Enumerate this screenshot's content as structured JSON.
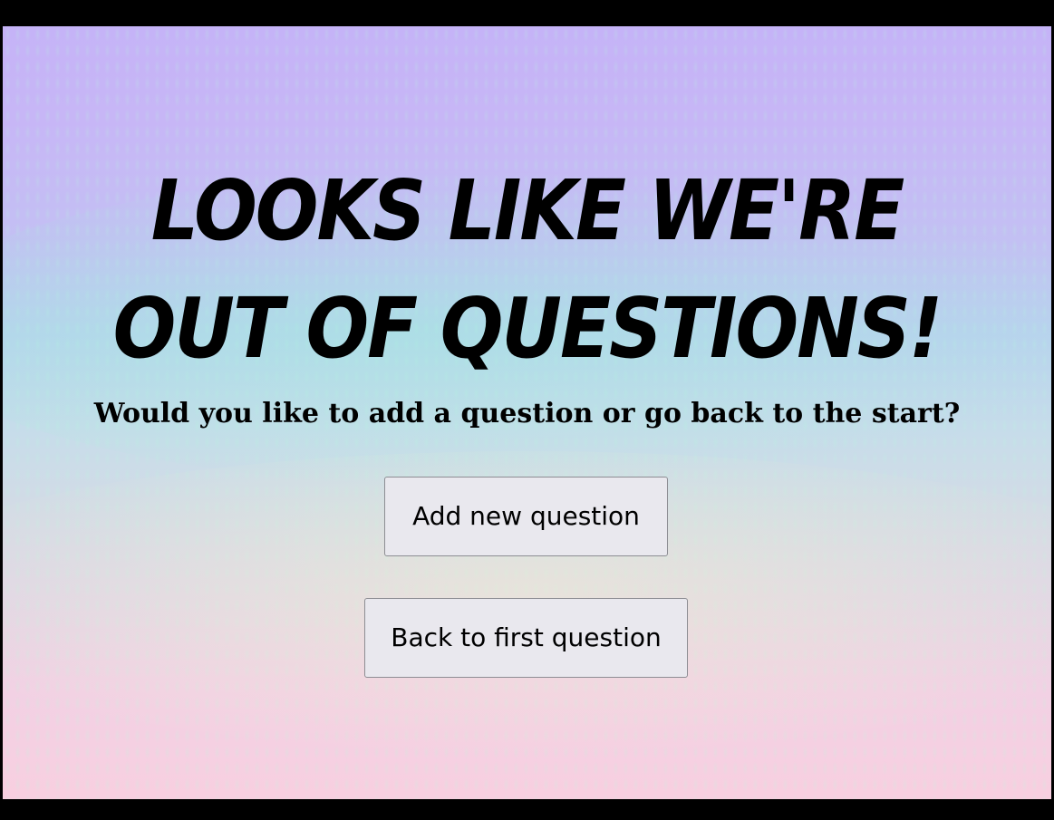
{
  "page": {
    "headline": "Looks like we're out of questions!",
    "subtitle": "Would you like to add a question or go back to the start?"
  },
  "actions": {
    "add_label": "Add new question",
    "back_label": "Back to first question"
  },
  "colors": {
    "frame": "#000000",
    "background_top": "#c5b3f7",
    "background_bottom": "#f8cfe0",
    "button_fill": "#e9e8ee",
    "button_border": "#8d8d93"
  }
}
